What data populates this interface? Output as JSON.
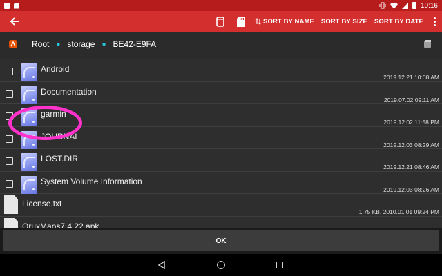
{
  "status_bar": {
    "time": "10:16"
  },
  "toolbar": {
    "sort_by_name": "SORT BY NAME",
    "sort_by_size": "SORT BY SIZE",
    "sort_by_date": "SORT BY DATE"
  },
  "path": {
    "crumbs": [
      "Root",
      "storage",
      "BE42-E9FA"
    ]
  },
  "folders": [
    {
      "name": "Android",
      "date": "2019.12.21 10:08 AM"
    },
    {
      "name": "Documentation",
      "date": "2019.07.02 09:11 AM"
    },
    {
      "name": "garmin",
      "date": "2019.12.02 11:58 PM"
    },
    {
      "name": "JOURNAL",
      "date": "2019.12.03 08:29 AM"
    },
    {
      "name": "LOST.DIR",
      "date": "2019.12.21 08:46 AM"
    },
    {
      "name": "System Volume Information",
      "date": "2019.12.03 08:26 AM"
    }
  ],
  "files": [
    {
      "name": "License.txt",
      "date": "1.75 KB, 2010.01.01 09:24 PM"
    },
    {
      "name": "OruxMaps7.4.22.apk",
      "date": ""
    }
  ],
  "ok_label": "OK",
  "icons": [
    "back-arrow-icon",
    "sd-storage-icon",
    "sd-card-icon",
    "sort-icon",
    "more-vert-icon",
    "folder-icon",
    "file-icon",
    "refresh-icon"
  ],
  "colors": {
    "status_bar": "#b71c1c",
    "toolbar": "#d32f2f",
    "list_bg": "#2e2e2e",
    "highlight": "#ff33cc",
    "accent": "#26c6da"
  }
}
